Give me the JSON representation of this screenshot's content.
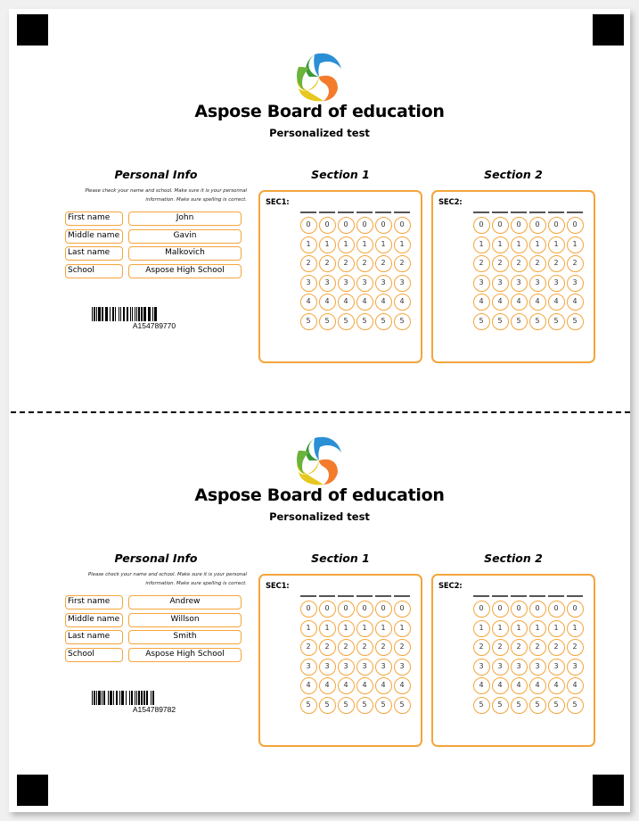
{
  "colors": {
    "accent_orange": "#f4a53c",
    "marker_black": "#000000"
  },
  "sheets": [
    {
      "logo_icon": "aspose-swirl-logo",
      "title": "Aspose Board of education",
      "subtitle": "Personalized test",
      "personal_info": {
        "heading": "Personal Info",
        "instructions": "Please check your name and school. Make sure it is your personnal information. Make sure spelling is correct.",
        "fields": [
          {
            "label": "First name",
            "value": "John"
          },
          {
            "label": "Middle name",
            "value": "Gavin"
          },
          {
            "label": "Last name",
            "value": "Malkovich"
          },
          {
            "label": "School",
            "value": "Aspose High School"
          }
        ],
        "barcode_text": "A154789770"
      },
      "sections": [
        {
          "heading": "Section 1",
          "label": "SEC1:",
          "columns": 6,
          "choices": [
            "0",
            "1",
            "2",
            "3",
            "4",
            "5"
          ]
        },
        {
          "heading": "Section 2",
          "label": "SEC2:",
          "columns": 6,
          "choices": [
            "0",
            "1",
            "2",
            "3",
            "4",
            "5"
          ]
        }
      ]
    },
    {
      "logo_icon": "aspose-swirl-logo",
      "title": "Aspose Board of education",
      "subtitle": "Personalized test",
      "personal_info": {
        "heading": "Personal Info",
        "instructions": "Please check your name and school. Make sure it is your personal information. Make sure spelling is correct.",
        "fields": [
          {
            "label": "First name",
            "value": "Andrew"
          },
          {
            "label": "Middle name",
            "value": "Willson"
          },
          {
            "label": "Last name",
            "value": "Smith"
          },
          {
            "label": "School",
            "value": "Aspose High School"
          }
        ],
        "barcode_text": "A154789782"
      },
      "sections": [
        {
          "heading": "Section 1",
          "label": "SEC1:",
          "columns": 6,
          "choices": [
            "0",
            "1",
            "2",
            "3",
            "4",
            "5"
          ]
        },
        {
          "heading": "Section 2",
          "label": "SEC2:",
          "columns": 6,
          "choices": [
            "0",
            "1",
            "2",
            "3",
            "4",
            "5"
          ]
        }
      ]
    }
  ]
}
